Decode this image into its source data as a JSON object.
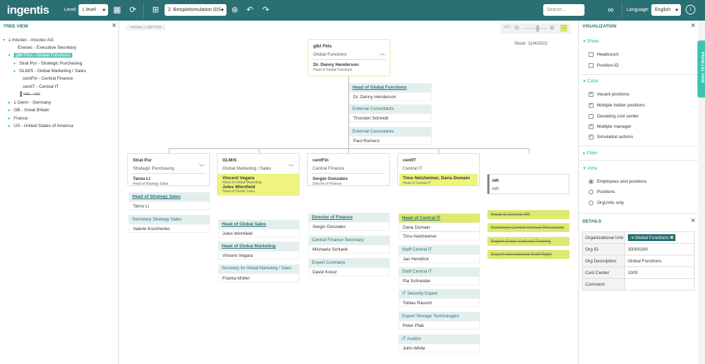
{
  "topbar": {
    "logo": "ingentis",
    "level_label": "Level:",
    "level_value": "1 level",
    "simulation_value": "2. Beispielsimulation iDS",
    "search_placeholder": "Search...",
    "language_label": "Language:",
    "language_value": "English"
  },
  "tree": {
    "title": "TREE VIEW",
    "items": [
      {
        "label": "misctec - misctec AG"
      },
      {
        "label": "Exesec - Executive Secretary"
      },
      {
        "label": "glbl Fkts - Global Functions"
      },
      {
        "label": "Strat Pur - Strategic Purchasing"
      },
      {
        "label": "GLM/S - Global Marketing / Sales"
      },
      {
        "label": "centFin - Central Finance"
      },
      {
        "label": "centIT - Central IT"
      },
      {
        "label": "HR - HR"
      },
      {
        "label": "Germ - Germany"
      },
      {
        "label": "GB - Great Britain"
      },
      {
        "label": "France"
      },
      {
        "label": "US - United States of America"
      }
    ]
  },
  "canvas": {
    "breadcrumb": "misctec  >  glbl Fkts",
    "stock": "Stock: 11/4/2022",
    "zoom": "99%",
    "root": {
      "code": "glbl Fkts",
      "name": "Global Functions",
      "manager": "Dr. Danny Henderson",
      "manager_role": "Head of Global Functions",
      "positions": [
        {
          "title": "Head of Global Functions",
          "holder": "Dr. Danny Henderson"
        },
        {
          "title": "External Consultants",
          "holder": "Thorsten Schmidt"
        },
        {
          "title": "External Consultants",
          "holder": "Paul Romero"
        }
      ]
    },
    "units": [
      {
        "code": "Strat Pur",
        "name": "Strategic Purchasing",
        "manager": "Tarou Li",
        "manager_role": "Head of Strategy Sales",
        "positions": [
          {
            "title": "Head of Strategy Sales",
            "holder": "Tarou Li"
          },
          {
            "title": "Secretary Strategy Sales",
            "holder": "Valerie Koschenko"
          }
        ]
      },
      {
        "code": "GLM/S",
        "name": "Global Marketing / Sales",
        "manager": "Vincent Vegara",
        "manager_role": "Head of Global Marketing",
        "manager2": "Jules Winnfield",
        "manager2_role": "Head of Global Sales",
        "positions": [
          {
            "title": "Head of Global Sales",
            "holder": "Jules Winnfield"
          },
          {
            "title": "Head of Global Marketing",
            "holder": "Vincent Vegara"
          },
          {
            "title": "Secretary for Global Marketing / Sales",
            "holder": "Franka Müller"
          }
        ]
      },
      {
        "code": "centFin",
        "name": "Central Finance",
        "manager": "Sergio Gonzales",
        "manager_role": "Director of Finance",
        "positions": [
          {
            "title": "Director of Finance",
            "holder": "Sergio Gonzales"
          },
          {
            "title": "Central Finance Secretary",
            "holder": "Michaela Schlank"
          },
          {
            "title": "Expert Contracts",
            "holder": "David Kreuz"
          }
        ]
      },
      {
        "code": "centIT",
        "name": "Central IT",
        "manager": "Timo Netzheimer, Daria Domain",
        "manager_role": "Head of Central IT",
        "positions": [
          {
            "title": "Head of Central IT",
            "holder": "Daria Domain",
            "holder2": "Timo Netzheimer"
          },
          {
            "title": "Staff Central IT",
            "holder": "Jan Hendrick"
          },
          {
            "title": "Staff Central IT",
            "holder": "Pia Schneider"
          },
          {
            "title": "IT Security Expert",
            "holder": "Tobias Rausch"
          },
          {
            "title": "Expert Storage Technologies",
            "holder": "Peter Pfab"
          },
          {
            "title": "IT Auditor",
            "holder": "John White"
          }
        ]
      },
      {
        "code": "HR",
        "name": "HR",
        "positions": [
          {
            "title": "Head of Central HR"
          },
          {
            "title": "Secretary Central Human Resources"
          },
          {
            "title": "Expert Cross-Cultural Training"
          },
          {
            "title": "Expert International Staff Right"
          }
        ]
      }
    ]
  },
  "visualization": {
    "title": "VISUALIZATION",
    "show_label": "Show",
    "show_options": [
      "Headcount",
      "Position-ID"
    ],
    "color_label": "Color",
    "color_options": [
      "Vacant positions",
      "Multiple holder positions",
      "Deviating cost center",
      "Multiple manager",
      "Simulation actions"
    ],
    "filter_label": "Filter",
    "view_label": "View",
    "view_options": [
      "Employees and positions",
      "Positions",
      "OrgUnits only"
    ],
    "side_tab": "PARALLEL VIEW"
  },
  "details": {
    "title": "DETAILS",
    "rows": [
      {
        "key": "Organizational Unit",
        "value": "Global Functions"
      },
      {
        "key": "Org ID",
        "value": "30000200"
      },
      {
        "key": "Org Description",
        "value": "Global Functions"
      },
      {
        "key": "Cost Center",
        "value": "1000"
      },
      {
        "key": "Comment",
        "value": ""
      }
    ]
  }
}
